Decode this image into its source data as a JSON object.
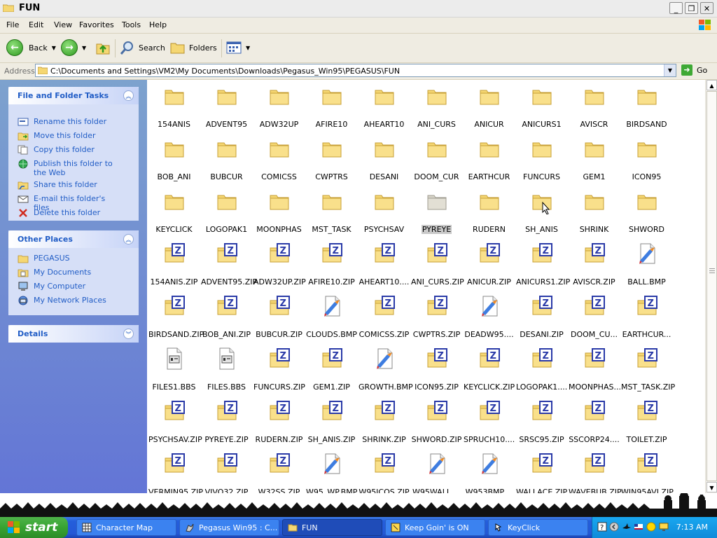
{
  "window": {
    "title": "FUN"
  },
  "menu": [
    "File",
    "Edit",
    "View",
    "Favorites",
    "Tools",
    "Help"
  ],
  "toolbar": {
    "back": "Back",
    "search": "Search",
    "folders": "Folders"
  },
  "address": {
    "label": "Address",
    "path": "C:\\Documents and Settings\\VM2\\My Documents\\Downloads\\Pegasus_Win95\\PEGASUS\\FUN",
    "go": "Go"
  },
  "left_panels": {
    "tasks": {
      "title": "File and Folder Tasks",
      "items": [
        {
          "label": "Rename this folder",
          "icon": "rename-icon"
        },
        {
          "label": "Move this folder",
          "icon": "move-icon"
        },
        {
          "label": "Copy this folder",
          "icon": "copy-icon"
        },
        {
          "label": "Publish this folder to the Web",
          "icon": "globe-icon"
        },
        {
          "label": "Share this folder",
          "icon": "share-icon"
        },
        {
          "label": "E-mail this folder's files",
          "icon": "email-icon"
        },
        {
          "label": "Delete this folder",
          "icon": "delete-icon"
        }
      ]
    },
    "places": {
      "title": "Other Places",
      "items": [
        {
          "label": "PEGASUS",
          "icon": "folder-icon"
        },
        {
          "label": "My Documents",
          "icon": "documents-icon"
        },
        {
          "label": "My Computer",
          "icon": "computer-icon"
        },
        {
          "label": "My Network Places",
          "icon": "network-icon"
        }
      ]
    },
    "details": {
      "title": "Details"
    }
  },
  "files": [
    {
      "name": "154ANIS",
      "type": "folder"
    },
    {
      "name": "ADVENT95",
      "type": "folder"
    },
    {
      "name": "ADW32UP",
      "type": "folder"
    },
    {
      "name": "AFIRE10",
      "type": "folder"
    },
    {
      "name": "AHEART10",
      "type": "folder"
    },
    {
      "name": "ANI_CURS",
      "type": "folder"
    },
    {
      "name": "ANICUR",
      "type": "folder"
    },
    {
      "name": "ANICURS1",
      "type": "folder"
    },
    {
      "name": "AVISCR",
      "type": "folder"
    },
    {
      "name": "BIRDSAND",
      "type": "folder"
    },
    {
      "name": "BOB_ANI",
      "type": "folder"
    },
    {
      "name": "BUBCUR",
      "type": "folder"
    },
    {
      "name": "COMICSS",
      "type": "folder"
    },
    {
      "name": "CWPTRS",
      "type": "folder"
    },
    {
      "name": "DESANI",
      "type": "folder"
    },
    {
      "name": "DOOM_CUR",
      "type": "folder"
    },
    {
      "name": "EARTHCUR",
      "type": "folder"
    },
    {
      "name": "FUNCURS",
      "type": "folder"
    },
    {
      "name": "GEM1",
      "type": "folder"
    },
    {
      "name": "ICON95",
      "type": "folder"
    },
    {
      "name": "KEYCLICK",
      "type": "folder"
    },
    {
      "name": "LOGOPAK1",
      "type": "folder"
    },
    {
      "name": "MOONPHAS",
      "type": "folder"
    },
    {
      "name": "MST_TASK",
      "type": "folder"
    },
    {
      "name": "PSYCHSAV",
      "type": "folder"
    },
    {
      "name": "PYREYE",
      "type": "folder",
      "selected": true
    },
    {
      "name": "RUDERN",
      "type": "folder"
    },
    {
      "name": "SH_ANIS",
      "type": "folder"
    },
    {
      "name": "SHRINK",
      "type": "folder"
    },
    {
      "name": "SHWORD",
      "type": "folder"
    },
    {
      "name": "154ANIS.ZIP",
      "type": "zip"
    },
    {
      "name": "ADVENT95.ZIP",
      "type": "zip"
    },
    {
      "name": "ADW32UP.ZIP",
      "type": "zip"
    },
    {
      "name": "AFIRE10.ZIP",
      "type": "zip"
    },
    {
      "name": "AHEART10....",
      "type": "zip"
    },
    {
      "name": "ANI_CURS.ZIP",
      "type": "zip"
    },
    {
      "name": "ANICUR.ZIP",
      "type": "zip"
    },
    {
      "name": "ANICURS1.ZIP",
      "type": "zip"
    },
    {
      "name": "AVISCR.ZIP",
      "type": "zip"
    },
    {
      "name": "BALL.BMP",
      "type": "bmp"
    },
    {
      "name": "BIRDSAND.ZIP",
      "type": "zip"
    },
    {
      "name": "BOB_ANI.ZIP",
      "type": "zip"
    },
    {
      "name": "BUBCUR.ZIP",
      "type": "zip"
    },
    {
      "name": "CLOUDS.BMP",
      "type": "bmp"
    },
    {
      "name": "COMICSS.ZIP",
      "type": "zip"
    },
    {
      "name": "CWPTRS.ZIP",
      "type": "zip"
    },
    {
      "name": "DEADW95....",
      "type": "bmp"
    },
    {
      "name": "DESANI.ZIP",
      "type": "zip"
    },
    {
      "name": "DOOM_CU...",
      "type": "zip"
    },
    {
      "name": "EARTHCUR...",
      "type": "zip"
    },
    {
      "name": "FILES1.BBS",
      "type": "bbs"
    },
    {
      "name": "FILES.BBS",
      "type": "bbs"
    },
    {
      "name": "FUNCURS.ZIP",
      "type": "zip"
    },
    {
      "name": "GEM1.ZIP",
      "type": "zip"
    },
    {
      "name": "GROWTH.BMP",
      "type": "bmp"
    },
    {
      "name": "ICON95.ZIP",
      "type": "zip"
    },
    {
      "name": "KEYCLICK.ZIP",
      "type": "zip"
    },
    {
      "name": "LOGOPAK1....",
      "type": "zip"
    },
    {
      "name": "MOONPHAS...",
      "type": "zip"
    },
    {
      "name": "MST_TASK.ZIP",
      "type": "zip"
    },
    {
      "name": "PSYCHSAV.ZIP",
      "type": "zip"
    },
    {
      "name": "PYREYE.ZIP",
      "type": "zip"
    },
    {
      "name": "RUDERN.ZIP",
      "type": "zip"
    },
    {
      "name": "SH_ANIS.ZIP",
      "type": "zip"
    },
    {
      "name": "SHRINK.ZIP",
      "type": "zip"
    },
    {
      "name": "SHWORD.ZIP",
      "type": "zip"
    },
    {
      "name": "SPRUCH10....",
      "type": "zip"
    },
    {
      "name": "SRSC95.ZIP",
      "type": "zip"
    },
    {
      "name": "SSCORP24....",
      "type": "zip"
    },
    {
      "name": "TOILET.ZIP",
      "type": "zip"
    },
    {
      "name": "VERMIN95.ZIP",
      "type": "zip"
    },
    {
      "name": "VIVO32.ZIP",
      "type": "zip"
    },
    {
      "name": "W32SS.ZIP",
      "type": "zip"
    },
    {
      "name": "W95_WP.BMP",
      "type": "bmp"
    },
    {
      "name": "W95ICOS.ZIP",
      "type": "zip"
    },
    {
      "name": "W95WALL....",
      "type": "bmp"
    },
    {
      "name": "W953BMP....",
      "type": "bmp"
    },
    {
      "name": "WALLACE.ZIP",
      "type": "zip"
    },
    {
      "name": "WAVEBUB.ZIP",
      "type": "zip"
    },
    {
      "name": "WIN95AVI.ZIP",
      "type": "zip"
    }
  ],
  "taskbar": {
    "start": "start",
    "buttons": [
      {
        "label": "Character Map",
        "active": false,
        "icon": "charmap-icon"
      },
      {
        "label": "Pegasus Win95 : C...",
        "active": false,
        "icon": "pegasus-icon"
      },
      {
        "label": "FUN",
        "active": true,
        "icon": "folder-icon"
      },
      {
        "label": "Keep Goin' is ON",
        "active": false,
        "icon": "keepgoin-icon"
      },
      {
        "label": "KeyClick",
        "active": false,
        "icon": "keyclick-icon"
      }
    ],
    "clock": "7:13 AM"
  },
  "colors": {
    "folder": "#f5d773",
    "zip_badge": "#2a3aa8",
    "taskbar": "#245edb",
    "start": "#37a331"
  }
}
